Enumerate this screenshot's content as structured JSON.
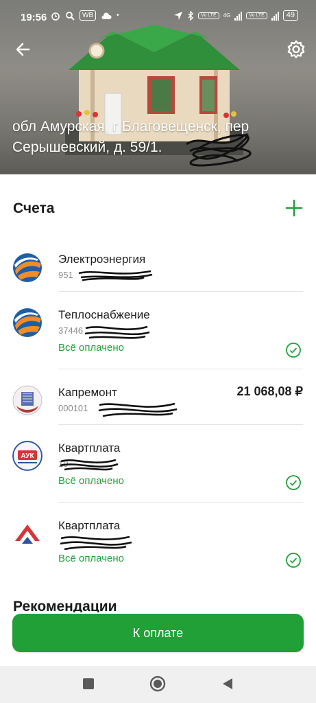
{
  "status_bar": {
    "time": "19:56",
    "sim_badge": "WB",
    "net1": "Vo LTE",
    "net2": "4G",
    "net3": "Vo LTE",
    "battery": "49"
  },
  "header": {
    "address": "обл Амурская, г Благовещенск, пер Серышевский, д. 59/1."
  },
  "accounts_section": {
    "title": "Счета"
  },
  "accounts": [
    {
      "name": "Электроэнергия",
      "number": "951",
      "status": "",
      "amount": ""
    },
    {
      "name": "Теплоснабжение",
      "number": "37446",
      "status": "Всё оплачено",
      "amount": ""
    },
    {
      "name": "Капремонт",
      "number": "000101",
      "status": "",
      "amount": "21 068,08 ₽"
    },
    {
      "name": "Квартплата",
      "number": "10",
      "status": "Всё оплачено",
      "amount": ""
    },
    {
      "name": "Квартплата",
      "number": "",
      "status": "Всё оплачено",
      "amount": ""
    }
  ],
  "recommendations": {
    "title": "Рекомендации"
  },
  "pay_button": {
    "label": "К оплате"
  },
  "colors": {
    "accent": "#21a038",
    "status_ok": "#21a038"
  },
  "icons": {
    "back": "arrow-left-icon",
    "settings": "gear-icon",
    "add": "plus-icon",
    "check": "check-circle-icon"
  }
}
